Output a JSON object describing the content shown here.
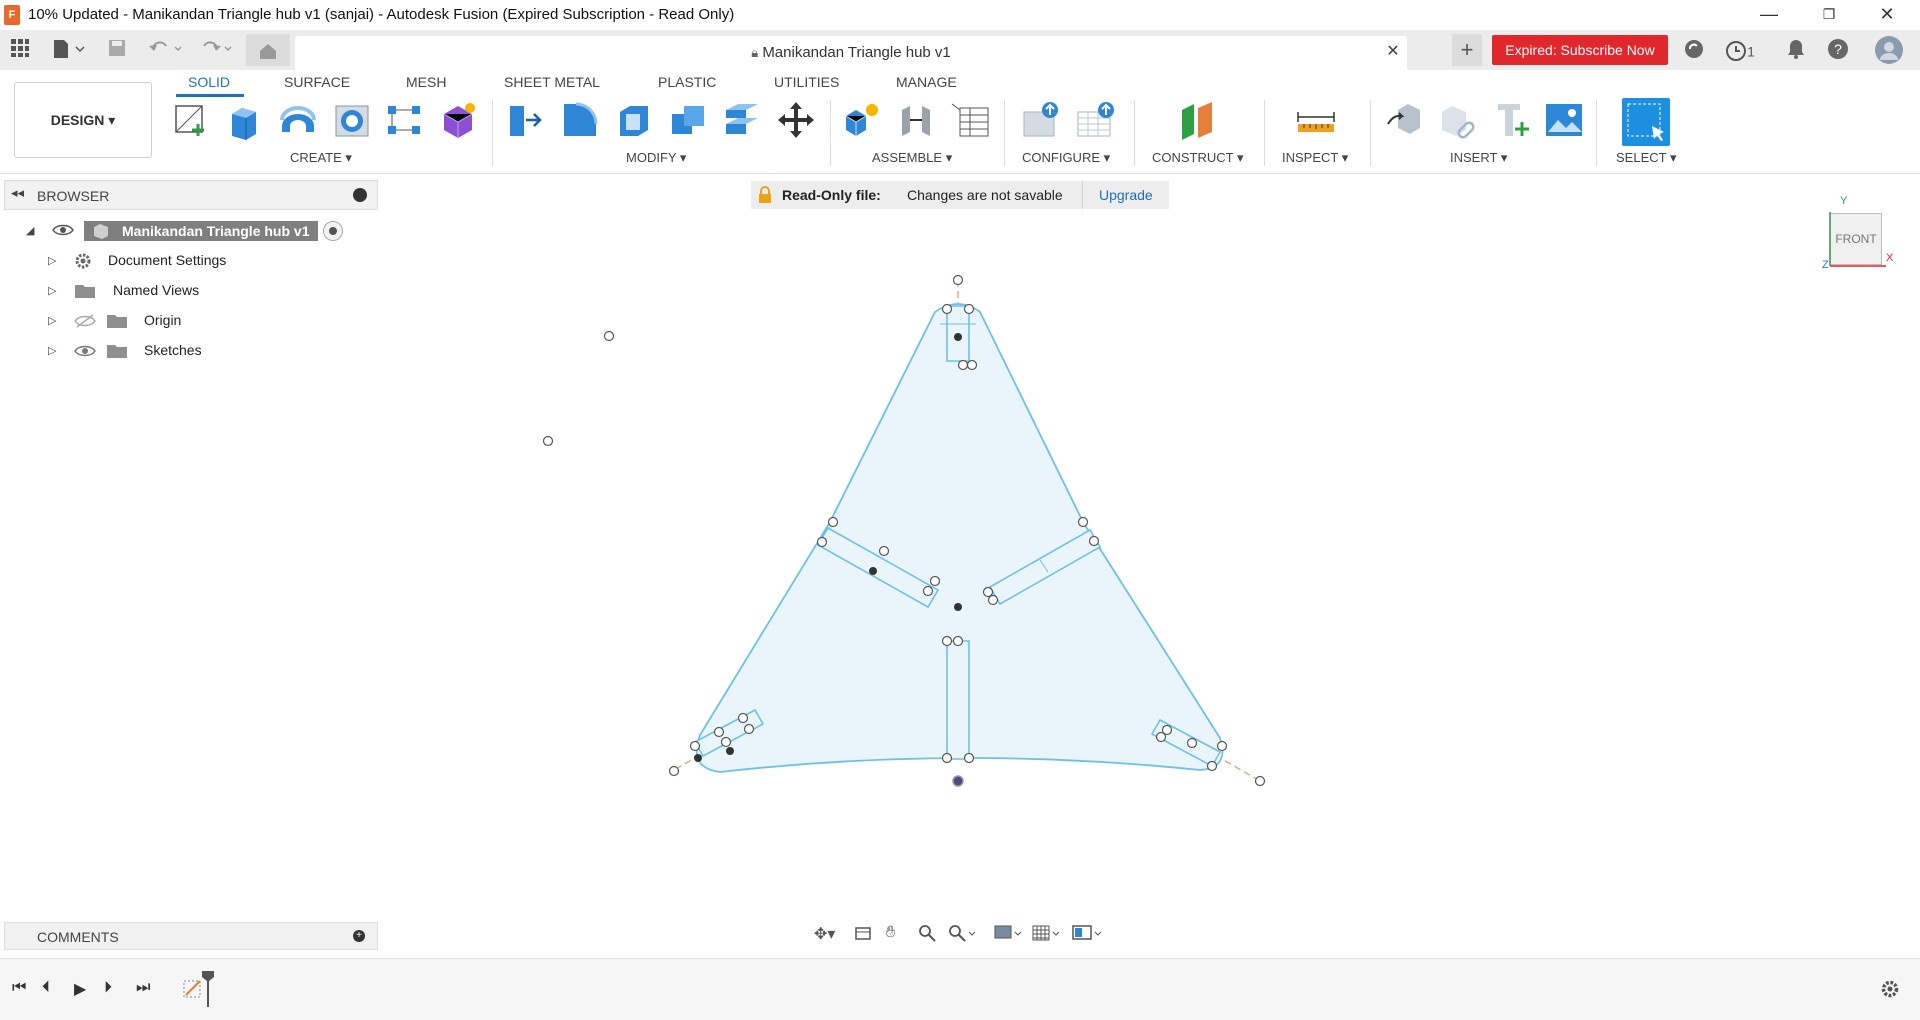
{
  "window": {
    "title": "10% Updated - Manikandan Triangle hub v1 (sanjai) - Autodesk Fusion (Expired Subscription - Read Only)",
    "app_icon_letter": "F"
  },
  "doc_tab": {
    "title": "Manikandan Triangle hub v1"
  },
  "header_actions": {
    "subscribe_label": "Expired: Subscribe Now",
    "jobs_count": "1"
  },
  "workspace": {
    "label": "DESIGN ▾"
  },
  "ribbon_tabs": [
    "SOLID",
    "SURFACE",
    "MESH",
    "SHEET METAL",
    "PLASTIC",
    "UTILITIES",
    "MANAGE"
  ],
  "ribbon_groups": [
    "CREATE ▾",
    "MODIFY ▾",
    "ASSEMBLE ▾",
    "CONFIGURE ▾",
    "CONSTRUCT ▾",
    "INSPECT ▾",
    "INSERT ▾",
    "SELECT ▾"
  ],
  "browser": {
    "title": "BROWSER",
    "root": "Manikandan Triangle hub v1",
    "items": [
      "Document Settings",
      "Named Views",
      "Origin",
      "Sketches"
    ]
  },
  "readonly_banner": {
    "label": "Read-Only file:",
    "message": "Changes are not savable",
    "action": "Upgrade"
  },
  "comments": {
    "title": "COMMENTS"
  },
  "viewcube": {
    "face": "FRONT",
    "axis_y": "Y",
    "axis_x": "X",
    "axis_z": "Z"
  },
  "accent_colors": {
    "active_tab": "#1a73c8",
    "subscribe": "#e0272b",
    "sketch_line": "#6ec1e4",
    "axis_line": "#e0a27a"
  }
}
